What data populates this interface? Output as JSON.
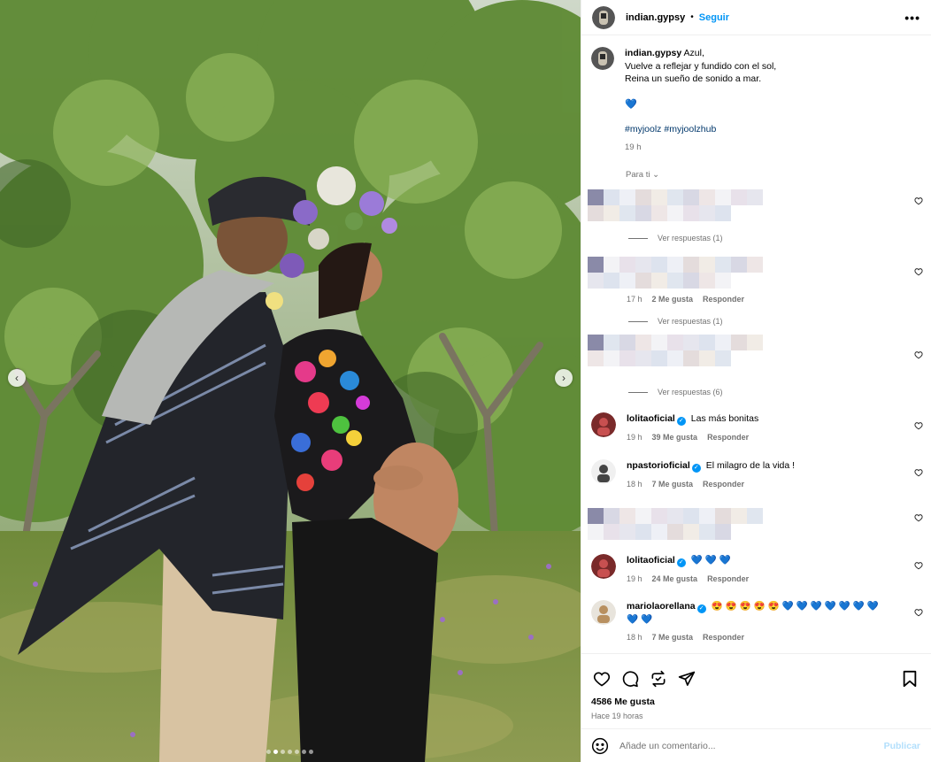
{
  "post": {
    "username": "indian.gypsy",
    "follow_label": "Seguir",
    "separator": "•",
    "more_label": "•••",
    "caption_lines": [
      "Azul,",
      "Vuelve a reflejar y fundido con el sol,",
      "Reina un sueño de sonido a mar."
    ],
    "caption_emoji": "💙",
    "hashtags": [
      "#myjoolz",
      "#myjoolzhub"
    ],
    "caption_time": "19 h",
    "filter_label": "Para ti",
    "filter_icon": "chevron-down-icon",
    "image_count": 7,
    "image_index": 2
  },
  "comments": [
    {
      "blurred": true,
      "replies": "Ver respuestas (1)"
    },
    {
      "blurred": true,
      "time": "17 h",
      "likes": "2 Me gusta",
      "reply": "Responder",
      "replies": "Ver respuestas (1)"
    },
    {
      "blurred": true,
      "replies": "Ver respuestas (6)"
    },
    {
      "user": "lolitaoficial",
      "text": "Las más bonitas",
      "time": "19 h",
      "likes": "39 Me gusta",
      "reply": "Responder"
    },
    {
      "user": "npastorioficial",
      "text": "El milagro de la vida !",
      "time": "18 h",
      "likes": "7 Me gusta",
      "reply": "Responder"
    },
    {
      "blurred": true
    },
    {
      "user": "lolitaoficial",
      "text": "💙 💙 💙",
      "time": "19 h",
      "likes": "24 Me gusta",
      "reply": "Responder"
    },
    {
      "user": "mariolaorellana",
      "text": "😍 😍 😍 😍 😍  💙 💙 💙 💙 💙 💙 💙 💙 💙",
      "time": "18 h",
      "likes": "7 Me gusta",
      "reply": "Responder"
    }
  ],
  "footer": {
    "likes": "4586 Me gusta",
    "ago": "Hace 19 horas",
    "comment_placeholder": "Añade un comentario...",
    "publish_label": "Publicar"
  },
  "icons": {
    "like": "heart-icon",
    "comment": "comment-icon",
    "share": "repost-icon",
    "send": "send-icon",
    "save": "bookmark-icon",
    "emoji": "emoji-icon",
    "prev": "chevron-left-icon",
    "next": "chevron-right-icon",
    "verified": "verified-badge-icon"
  },
  "colors": {
    "accent": "#0095f6",
    "muted": "#737373",
    "link": "#00376b",
    "heart_blue": "#3b82f6"
  }
}
